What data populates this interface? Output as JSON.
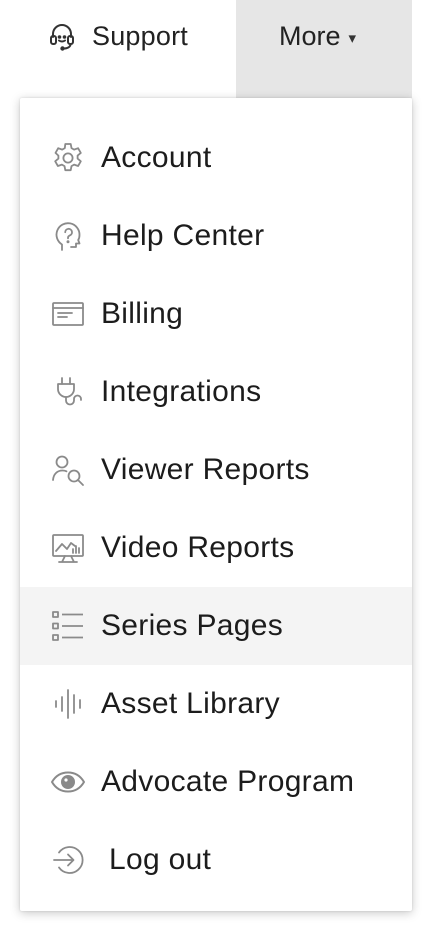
{
  "topnav": {
    "support_label": "Support",
    "more_label": "More",
    "more_caret": "▾"
  },
  "menu": {
    "items": [
      {
        "label": "Account",
        "icon": "gear-icon"
      },
      {
        "label": "Help Center",
        "icon": "help-bubble-icon"
      },
      {
        "label": "Billing",
        "icon": "billing-icon"
      },
      {
        "label": "Integrations",
        "icon": "plug-icon"
      },
      {
        "label": "Viewer Reports",
        "icon": "person-search-icon"
      },
      {
        "label": "Video Reports",
        "icon": "monitor-chart-icon"
      },
      {
        "label": "Series Pages",
        "icon": "list-icon"
      },
      {
        "label": "Asset Library",
        "icon": "waveform-icon"
      },
      {
        "label": "Advocate Program",
        "icon": "eye-icon"
      },
      {
        "label": "Log out",
        "icon": "logout-icon"
      }
    ],
    "active_item": "Series Pages"
  },
  "colors": {
    "more_bg": "#e6e6e6",
    "active_row_bg": "#f4f4f4",
    "icon_stroke": "#8a8a8a",
    "text": "#1c1c1c"
  }
}
